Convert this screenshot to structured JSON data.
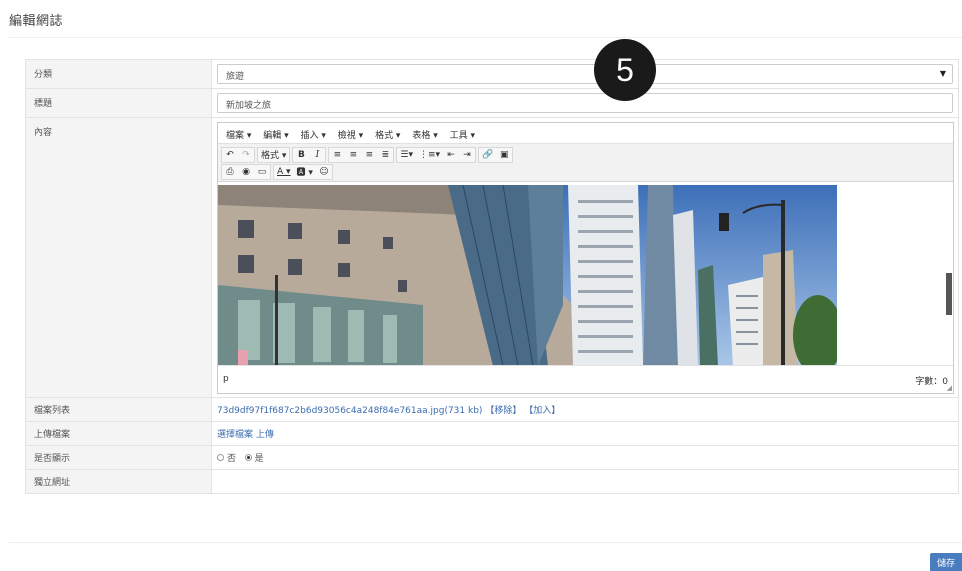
{
  "page": {
    "title": "編輯網誌"
  },
  "form": {
    "category": {
      "label": "分類",
      "value": "旅遊"
    },
    "title": {
      "label": "標題",
      "value": "新加坡之旅"
    },
    "content": {
      "label": "內容"
    },
    "file_list": {
      "label": "檔案列表",
      "file": "73d9df97f1f687c2b6d93056c4a248f84e761aa.jpg(731 kb)",
      "remove": "【移除】",
      "add": "【加入】"
    },
    "upload": {
      "label": "上傳檔案",
      "choose": "選擇檔案",
      "upload": "上傳"
    },
    "display": {
      "label": "是否顯示",
      "no": "否",
      "yes": "是",
      "selected": "yes"
    },
    "url": {
      "label": "獨立網址",
      "value": ""
    }
  },
  "editor": {
    "menu": [
      "檔案 ▾",
      "編輯 ▾",
      "插入 ▾",
      "檢視 ▾",
      "格式 ▾",
      "表格 ▾",
      "工具 ▾"
    ],
    "toolbar": {
      "format_label": "格式 ▾"
    },
    "status_path": "p",
    "word_count": "字數：0"
  },
  "badge": {
    "number": "5"
  },
  "actions": {
    "save": "儲存"
  }
}
